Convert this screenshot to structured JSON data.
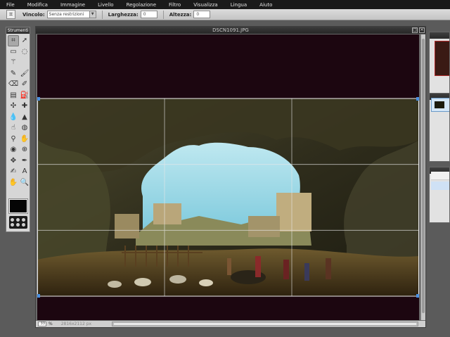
{
  "menubar": {
    "items": [
      "File",
      "Modifica",
      "Immagine",
      "Livello",
      "Regolazione",
      "Filtro",
      "Visualizza",
      "Lingua",
      "Aiuto"
    ]
  },
  "options": {
    "constraint_label": "Vincolo:",
    "constraint_value": "Senza restrizioni",
    "width_label": "Larghezza:",
    "width_value": "0",
    "height_label": "Altezza:",
    "height_value": "0"
  },
  "toolbox": {
    "title": "Strumenti",
    "tools": [
      {
        "name": "crop-tool",
        "icon": "crop-icon",
        "glyph": "⌗",
        "active": true
      },
      {
        "name": "move-tool",
        "icon": "move-arrow-icon",
        "glyph": "➚",
        "active": false
      },
      {
        "name": "marquee-tool",
        "icon": "rect-select-icon",
        "glyph": "▭",
        "active": false
      },
      {
        "name": "lasso-tool",
        "icon": "lasso-icon",
        "glyph": "◌",
        "active": false
      },
      {
        "name": "wand-tool",
        "icon": "magic-wand-icon",
        "glyph": "⚚",
        "active": false
      },
      {
        "name": "blank-tool",
        "icon": "none",
        "glyph": "",
        "active": false
      },
      {
        "name": "pencil-tool",
        "icon": "pencil-icon",
        "glyph": "✎",
        "active": false
      },
      {
        "name": "brush-tool",
        "icon": "brush-icon",
        "glyph": "🖌",
        "active": false
      },
      {
        "name": "eraser-tool",
        "icon": "eraser-icon",
        "glyph": "⌫",
        "active": false
      },
      {
        "name": "replace-tool",
        "icon": "color-replace-icon",
        "glyph": "✐",
        "active": false
      },
      {
        "name": "gradient-tool",
        "icon": "gradient-icon",
        "glyph": "▤",
        "active": false
      },
      {
        "name": "fill-tool",
        "icon": "paint-bucket-icon",
        "glyph": "⛽",
        "active": false
      },
      {
        "name": "clone-tool",
        "icon": "clone-stamp-icon",
        "glyph": "✣",
        "active": false
      },
      {
        "name": "heal-tool",
        "icon": "healing-icon",
        "glyph": "✚",
        "active": false
      },
      {
        "name": "blur-tool",
        "icon": "blur-drop-icon",
        "glyph": "💧",
        "active": false
      },
      {
        "name": "sharpen-tool",
        "icon": "sharpen-icon",
        "glyph": "▲",
        "active": false
      },
      {
        "name": "smudge-tool",
        "icon": "smudge-finger-icon",
        "glyph": "☝",
        "active": false
      },
      {
        "name": "sponge-tool",
        "icon": "sponge-icon",
        "glyph": "◍",
        "active": false
      },
      {
        "name": "dodge-tool",
        "icon": "dodge-icon",
        "glyph": "⚲",
        "active": false
      },
      {
        "name": "burn-tool",
        "icon": "burn-icon",
        "glyph": "✋",
        "active": false
      },
      {
        "name": "redeye-tool",
        "icon": "red-eye-icon",
        "glyph": "◉",
        "active": false
      },
      {
        "name": "bloat-tool",
        "icon": "bloat-icon",
        "glyph": "⊕",
        "active": false
      },
      {
        "name": "pinch-tool",
        "icon": "pinch-icon",
        "glyph": "✥",
        "active": false
      },
      {
        "name": "picker-tool",
        "icon": "eyedropper-icon",
        "glyph": "✒",
        "active": false
      },
      {
        "name": "draw-tool",
        "icon": "pen-icon",
        "glyph": "✍",
        "active": false
      },
      {
        "name": "text-tool",
        "icon": "text-icon",
        "glyph": "A",
        "active": false
      },
      {
        "name": "hand-tool",
        "icon": "hand-icon",
        "glyph": "✋",
        "active": false
      },
      {
        "name": "zoom-tool",
        "icon": "zoom-icon",
        "glyph": "🔍",
        "active": false
      }
    ]
  },
  "document": {
    "title": "DSCN1091.JPG",
    "zoom": "33",
    "zoom_unit": "%",
    "dimensions": "2816x2112 px"
  },
  "colors": {
    "accent": "#4a90e2",
    "menubar_bg": "#1a1a1a",
    "workspace_bg": "#5b5b5b",
    "canvas_bg": "#1c0610",
    "foreground_color": "#050505"
  }
}
